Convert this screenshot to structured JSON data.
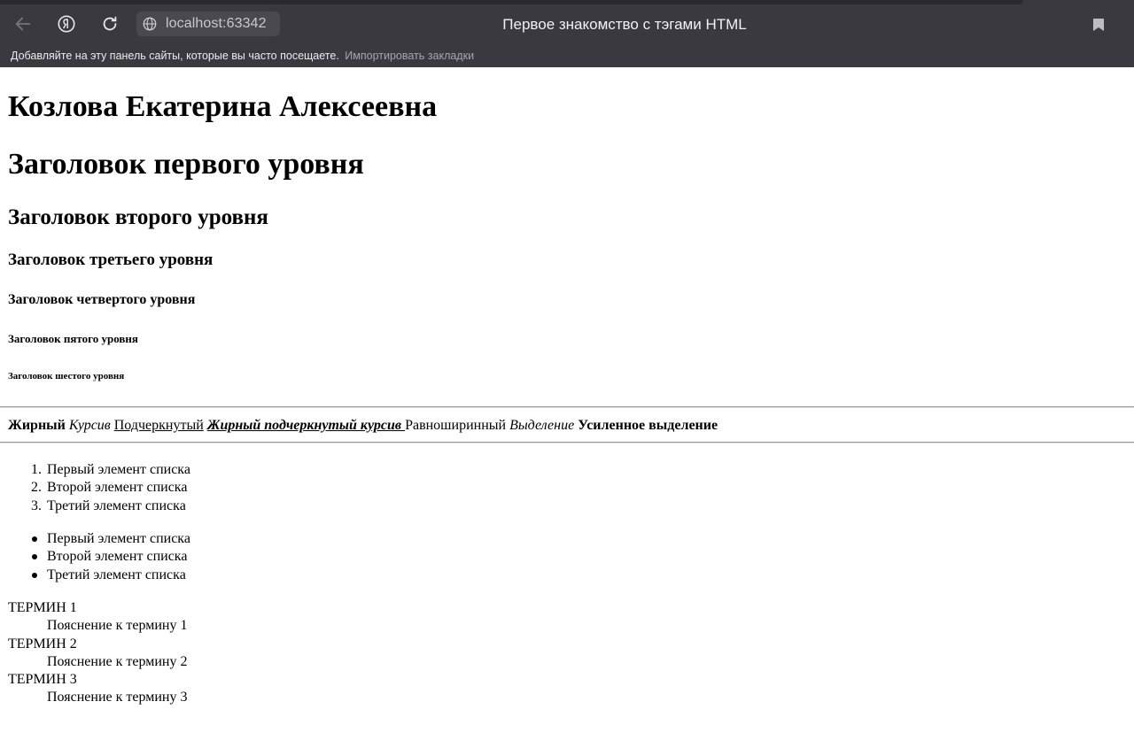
{
  "browser": {
    "url": "localhost:63342",
    "tab_title": "Первое знакомство с тэгами HTML",
    "bookmarks_hint": "Добавляйте на эту панель сайты, которые вы часто посещаете.",
    "bookmarks_import": "Импортировать закладки"
  },
  "page": {
    "author": "Козлова Екатерина Алексеевна",
    "h1": "Заголовок первого уровня",
    "h2": "Заголовок второго уровня",
    "h3": "Заголовок третьего уровня",
    "h4": "Заголовок четвертого уровня",
    "h5": "Заголовок пятого уровня",
    "h6": "Заголовок шестого уровня",
    "styles": {
      "bold": "Жирный",
      "italic": "Курсив",
      "underline": "Подчеркнутый",
      "bold_underline_italic": "Жирный подчеркнутый курсив ",
      "monospace": "Равноширинный",
      "emphasis": "Выделение",
      "strong": "Усиленное выделение"
    },
    "ordered_list": [
      {
        "marker": "1.",
        "text": "Первый элемент списка"
      },
      {
        "marker": "2.",
        "text": "Второй элемент списка"
      },
      {
        "marker": "3.",
        "text": "Третий элемент списка"
      }
    ],
    "unordered_list": [
      "Первый элемент списка",
      "Второй элемент списка",
      "Третий элемент списка"
    ],
    "definitions": [
      {
        "term": "ТЕРМИН 1",
        "desc": "Пояснение к термину 1"
      },
      {
        "term": "ТЕРМИН 2",
        "desc": "Пояснение к термину 2"
      },
      {
        "term": "ТЕРМИН 3",
        "desc": "Пояснение к термину 3"
      }
    ]
  }
}
